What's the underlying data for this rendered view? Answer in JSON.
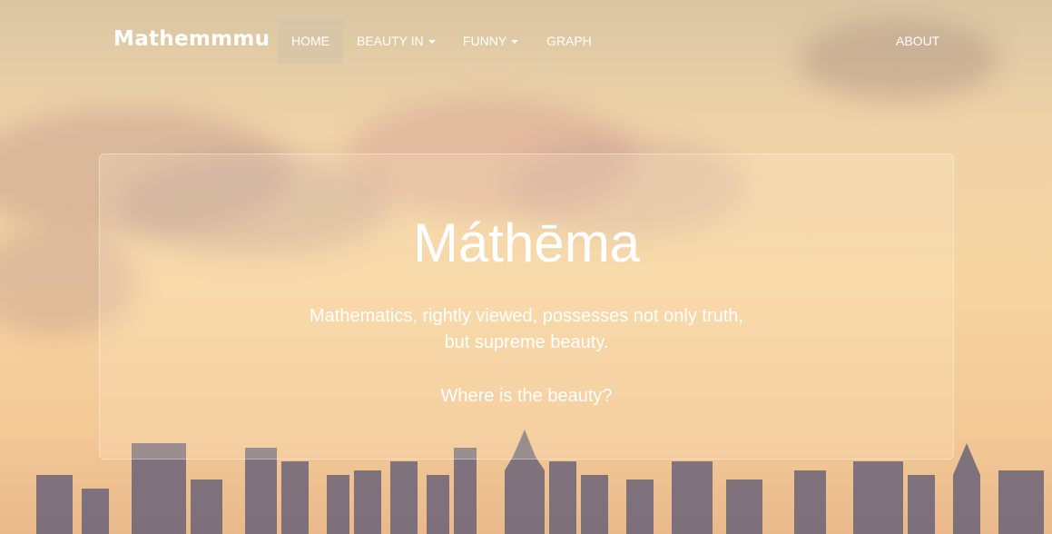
{
  "navbar": {
    "brand": "Mathemmmu",
    "items": [
      {
        "label": "HOME",
        "active": true,
        "dropdown": false
      },
      {
        "label": "BEAUTY IN",
        "active": false,
        "dropdown": true
      },
      {
        "label": "FUNNY",
        "active": false,
        "dropdown": true
      },
      {
        "label": "GRAPH",
        "active": false,
        "dropdown": false
      }
    ],
    "right_item": "ABOUT"
  },
  "hero": {
    "title": "Máthēma",
    "quote_line1": "Mathematics, rightly viewed, possesses not only truth,",
    "quote_line2": "but supreme beauty.",
    "question": "Where is the beauty?"
  },
  "colors": {
    "text": "#ffffff",
    "sky_top": "#d9c6a3",
    "sky_mid": "#f6d4a0",
    "active_nav_bg": "#d2c3aa"
  }
}
